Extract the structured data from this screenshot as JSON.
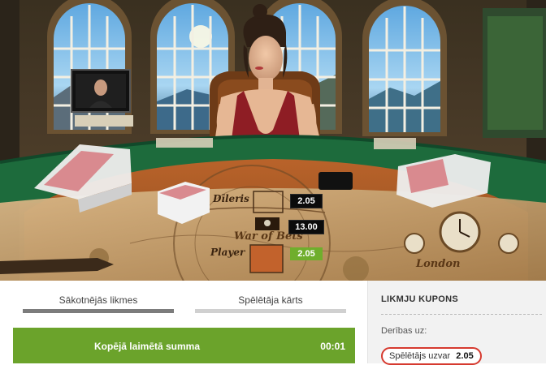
{
  "table": {
    "dealer_label": "Dīleris",
    "player_label": "Player",
    "map_text_1": "War of Bets",
    "map_text_2": "London",
    "dealer_odds": "2.05",
    "tie_odds": "13.00",
    "player_odds": "2.05"
  },
  "tabs": [
    {
      "label": "Sākotnējās likmes"
    },
    {
      "label": "Spēlētāja kārts"
    }
  ],
  "win_bar": {
    "label": "Kopējā laimētā summa",
    "timer": "00:01"
  },
  "coupon": {
    "title": "LIKMJU KUPONS",
    "bets_on": "Derības uz:",
    "selection": "Spēlētājs uzvar",
    "selection_odds": "2.05"
  },
  "colors": {
    "win_green": "#6ba32b",
    "odds_green": "#6fae2c",
    "highlight_red": "#d63a2f",
    "felt_green": "#1d6b3c",
    "table_orange": "#c97032"
  }
}
